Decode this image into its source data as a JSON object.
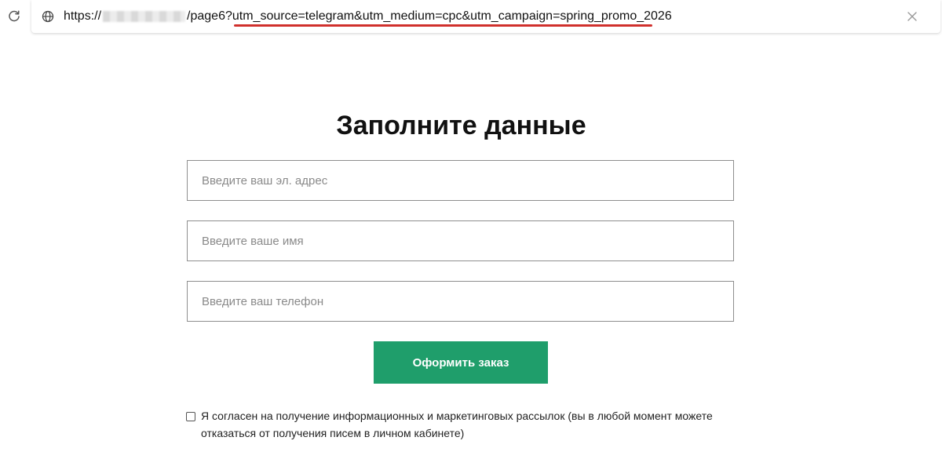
{
  "browser": {
    "url_prefix": "https://",
    "url_suffix": "/page6?utm_source=telegram&utm_medium=cpc&utm_campaign=spring_promo_2026",
    "icons": {
      "reload": "reload-icon",
      "site": "globe-icon",
      "close": "close-icon"
    },
    "highlight_color": "#d0302c"
  },
  "form": {
    "title": "Заполните данные",
    "email_placeholder": "Введите ваш эл. адрес",
    "name_placeholder": "Введите ваше имя",
    "phone_placeholder": "Введите ваш телефон",
    "submit_label": "Оформить заказ",
    "consent_line1": "Я согласен на получение информационных и маркетинговых рассылок (вы в любой момент можете",
    "consent_line2": "отказаться от получения писем в личном кабинете)",
    "consent_checked": false
  },
  "colors": {
    "button": "#1f9e6b",
    "input_border": "#8e8e8e"
  }
}
